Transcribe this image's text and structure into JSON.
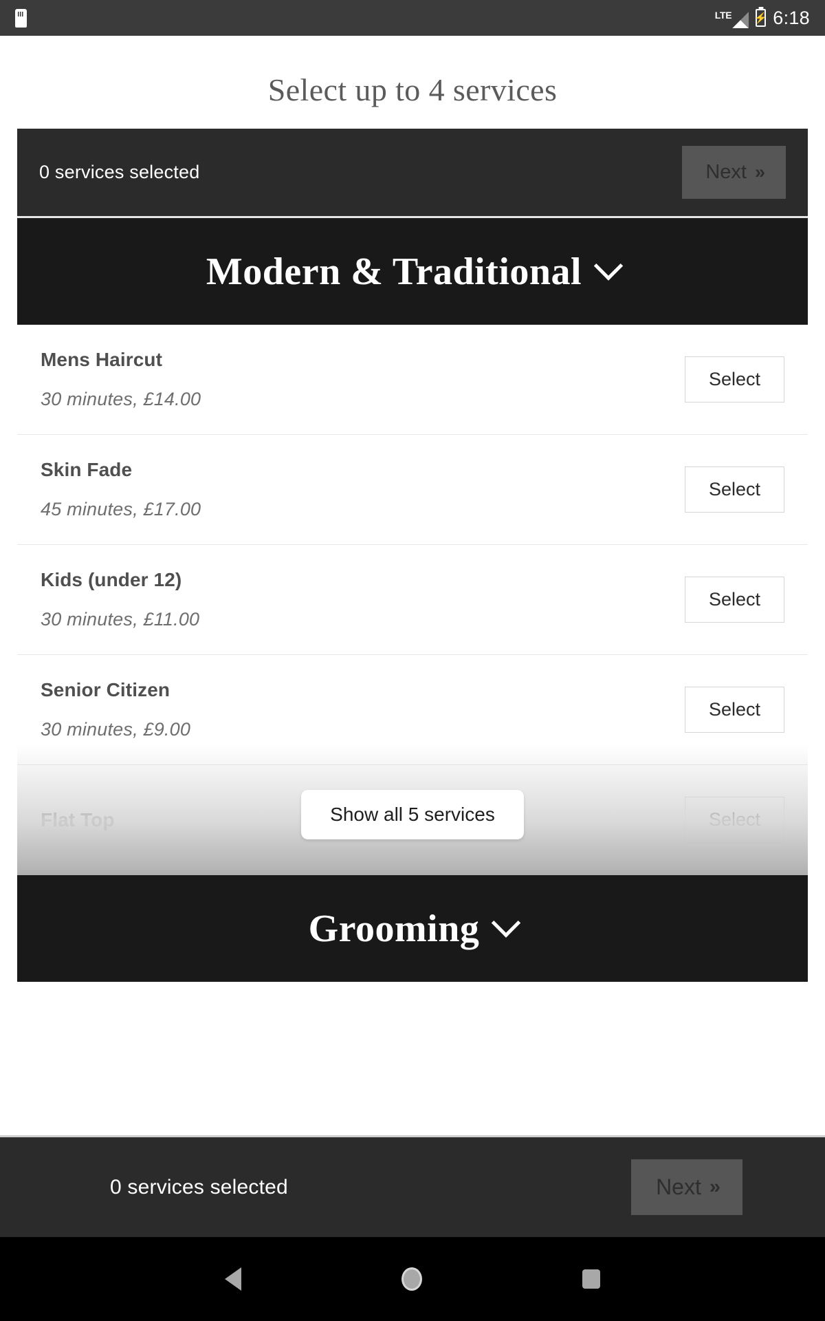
{
  "status_bar": {
    "sdcard_icon": "sdcard-icon",
    "network_label": "LTE",
    "signal_icon": "signal-bars-icon",
    "battery_icon": "battery-charging-icon",
    "battery_bolt": "⚡",
    "time": "6:18"
  },
  "page": {
    "heading": "Select up to 4 services"
  },
  "top_summary": {
    "selected_text": "0 services selected",
    "next_label": "Next",
    "next_chevron": "»"
  },
  "categories": [
    {
      "title": "Modern & Traditional",
      "chevron_icon": "chevron-down-icon",
      "services": [
        {
          "name": "Mens Haircut",
          "meta": "30 minutes, £14.00",
          "action": "Select"
        },
        {
          "name": "Skin Fade",
          "meta": "45 minutes, £17.00",
          "action": "Select"
        },
        {
          "name": "Kids (under 12)",
          "meta": "30 minutes, £11.00",
          "action": "Select"
        },
        {
          "name": "Senior Citizen",
          "meta": "30 minutes, £9.00",
          "action": "Select"
        },
        {
          "name": "Flat Top",
          "meta": "",
          "action": "Select"
        }
      ],
      "show_all_label": "Show all 5 services"
    },
    {
      "title": "Grooming",
      "chevron_icon": "chevron-down-icon",
      "services": [],
      "show_all_label": ""
    }
  ],
  "bottom_summary": {
    "selected_text": "0 services selected",
    "next_label": "Next",
    "next_chevron": "»"
  },
  "nav_bar": {
    "back_icon": "back-triangle-icon",
    "home_icon": "home-circle-icon",
    "recents_icon": "recents-square-icon"
  },
  "colors": {
    "statusbar_bg": "#3b3b3b",
    "summary_bg": "#2b2b2b",
    "category_bg": "#191919",
    "heading_text": "#5b5b5b",
    "service_name": "#4f4f4f",
    "service_meta": "#6e6e6e",
    "next_disabled_bg": "#565656"
  }
}
